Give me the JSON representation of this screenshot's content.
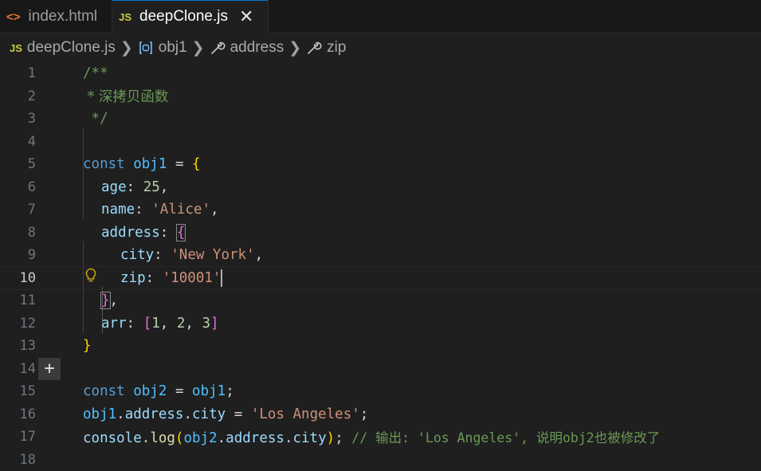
{
  "tabs": [
    {
      "label": "index.html",
      "icon": "html-file-icon"
    },
    {
      "label": "deepClone.js",
      "icon": "js-file-icon",
      "active": true
    }
  ],
  "breadcrumb": [
    "deepClone.js",
    "obj1",
    "address",
    "zip"
  ],
  "icon_text": {
    "html": "<>",
    "js": "JS",
    "close": "✕",
    "chevron": "❯",
    "plus": "+",
    "bulb": "💡"
  },
  "lines": [
    {
      "n": "1"
    },
    {
      "n": "2"
    },
    {
      "n": "3"
    },
    {
      "n": "4"
    },
    {
      "n": "5"
    },
    {
      "n": "6"
    },
    {
      "n": "7"
    },
    {
      "n": "8"
    },
    {
      "n": "9"
    },
    {
      "n": "10"
    },
    {
      "n": "11"
    },
    {
      "n": "12"
    },
    {
      "n": "13"
    },
    {
      "n": "14"
    },
    {
      "n": "15"
    },
    {
      "n": "16"
    },
    {
      "n": "17"
    },
    {
      "n": "18"
    }
  ],
  "code": {
    "l1": "/**",
    "l2": " * 深拷贝函数",
    "l3": " */",
    "l5": {
      "kw": "const",
      "name": "obj1",
      "eq": "=",
      "brace": "{"
    },
    "l6": {
      "key": "age",
      "colon": ":",
      "val": "25",
      "comma": ","
    },
    "l7": {
      "key": "name",
      "colon": ":",
      "val": "'Alice'",
      "comma": ","
    },
    "l8": {
      "key": "address",
      "colon": ":",
      "brace": "{"
    },
    "l9": {
      "key": "city",
      "colon": ":",
      "val": "'New York'",
      "comma": ","
    },
    "l10": {
      "key": "zip",
      "colon": ":",
      "val": "'10001'"
    },
    "l11": {
      "brace": "}",
      "comma": ","
    },
    "l12": {
      "key": "arr",
      "colon": ":",
      "open": "[",
      "v1": "1",
      "sep1": ", ",
      "v2": "2",
      "sep2": ", ",
      "v3": "3",
      "close": "]"
    },
    "l13": {
      "brace": "}"
    },
    "l15": {
      "kw": "const",
      "name": "obj2",
      "eq": "=",
      "rhs": "obj1",
      "semi": ";"
    },
    "l16": {
      "obj": "obj1",
      "p1": "address",
      "p2": "city",
      "eq": "=",
      "val": "'Los Angeles'",
      "semi": ";"
    },
    "l17": {
      "obj": "console",
      "fn": "log",
      "open": "(",
      "arg_obj": "obj2",
      "p1": "address",
      "p2": "city",
      "close": ")",
      "semi": ";",
      "comment": "// 输出: 'Los Angeles', 说明obj2也被修改了"
    }
  },
  "current_line": "10"
}
